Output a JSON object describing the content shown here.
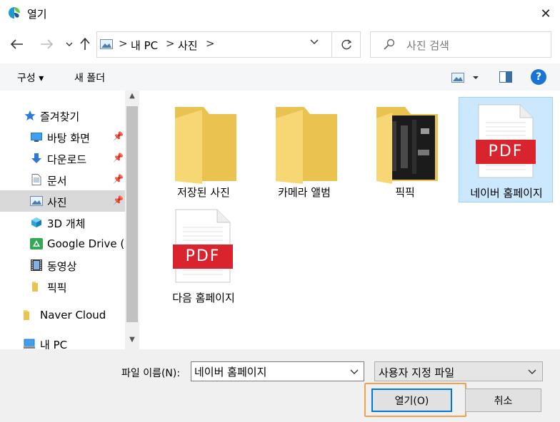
{
  "window": {
    "title": "열기",
    "close_glyph": "✕"
  },
  "address": {
    "breadcrumbs": [
      "내 PC",
      "사진"
    ],
    "separator": ">",
    "search_placeholder": "사진 검색"
  },
  "toolbar": {
    "organize_label": "구성 ▾",
    "newfolder_label": "새 폴더",
    "help_label": "?"
  },
  "nav": {
    "items": [
      {
        "label": "즐겨찾기",
        "icon": "star-icon",
        "pinned": false,
        "selected": false
      },
      {
        "label": "바탕 화면",
        "icon": "desktop-icon",
        "pinned": true,
        "selected": false
      },
      {
        "label": "다운로드",
        "icon": "download-arrow-icon",
        "pinned": true,
        "selected": false
      },
      {
        "label": "문서",
        "icon": "document-icon",
        "pinned": true,
        "selected": false
      },
      {
        "label": "사진",
        "icon": "pictures-icon",
        "pinned": true,
        "selected": true
      },
      {
        "label": "3D 개체",
        "icon": "cube-3d-icon",
        "pinned": false,
        "selected": false
      },
      {
        "label": "Google Drive (X",
        "icon": "google-drive-icon",
        "pinned": false,
        "selected": false
      },
      {
        "label": "동영상",
        "icon": "film-icon",
        "pinned": false,
        "selected": false
      },
      {
        "label": "픽픽",
        "icon": "folder-icon",
        "pinned": false,
        "selected": false
      },
      {
        "label": "Naver Cloud",
        "icon": "folder-icon",
        "pinned": false,
        "selected": false
      },
      {
        "label": "내 PC",
        "icon": "computer-icon",
        "pinned": false,
        "selected": false
      }
    ]
  },
  "files": [
    {
      "name": "저장된 사진",
      "type": "folder",
      "selected": false
    },
    {
      "name": "카메라 앨범",
      "type": "folder",
      "selected": false
    },
    {
      "name": "픽픽",
      "type": "folder-with-images",
      "selected": false
    },
    {
      "name": "네이버 홈페이지",
      "type": "pdf",
      "selected": true
    },
    {
      "name": "다음 홈페이지",
      "type": "pdf",
      "selected": false
    }
  ],
  "pdf_badge": "PDF",
  "bottom": {
    "filename_label": "파일 이름(N):",
    "filename_value": "네이버 홈페이지",
    "filetype_value": "사용자 지정 파일",
    "open_label": "열기(O)",
    "cancel_label": "취소"
  },
  "colors": {
    "accent": "#0078d7",
    "selection_bg": "#cce8ff",
    "selection_border": "#99d1ff",
    "pdf_red": "#d9232d",
    "folder_yellow": "#f7d774",
    "highlight_orange": "#f0a050"
  }
}
